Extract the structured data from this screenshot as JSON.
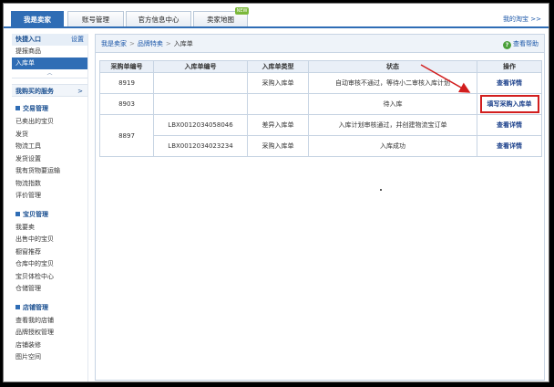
{
  "top_tabs": [
    {
      "label": "我是卖家",
      "active": true
    },
    {
      "label": "账号管理",
      "active": false
    },
    {
      "label": "官方信息中心",
      "active": false
    },
    {
      "label": "卖家地图",
      "active": false
    }
  ],
  "new_badge": "NEW",
  "my_taobao": "我的淘宝 >>",
  "sidebar": {
    "quick_entry": "快捷入口",
    "settings": "设置",
    "quick_items": [
      "提报商品",
      "入库单"
    ],
    "purchased_service": "我购买的服务",
    "service_arrow": ">",
    "groups": [
      {
        "title": "交易管理",
        "items": [
          "已卖出的宝贝",
          "发货",
          "物流工具",
          "发货设置",
          "我有货物要运输",
          "物流指数",
          "评价管理"
        ]
      },
      {
        "title": "宝贝管理",
        "items": [
          "我要卖",
          "出售中的宝贝",
          "橱窗推荐",
          "仓库中的宝贝",
          "宝贝体检中心",
          "仓储管理"
        ]
      },
      {
        "title": "店铺管理",
        "items": [
          "查看我的店铺",
          "品牌授权管理",
          "店铺装修",
          "图片空间"
        ]
      }
    ]
  },
  "breadcrumb": [
    "我是卖家",
    "品牌特卖",
    "入库单"
  ],
  "help": "查看帮助",
  "table": {
    "headers": [
      "采购单编号",
      "入库单编号",
      "入库单类型",
      "状态",
      "操作"
    ],
    "rows": [
      {
        "po": "8919",
        "inbound": "",
        "type": "采购入库单",
        "status": "自动审核不通过，等待小二审核入库计划",
        "action": "查看详情"
      },
      {
        "po": "8903",
        "inbound": "",
        "type": "",
        "status": "待入库",
        "action": "填写采购入库单"
      },
      {
        "po": "8897",
        "inbound": "LBX0012034058046",
        "type": "差异入库单",
        "status": "入库计划审核通过，并创建物流宝订单",
        "action": "查看详情"
      },
      {
        "po": "",
        "inbound": "LBX0012034023234",
        "type": "采购入库单",
        "status": "入库成功",
        "action": "查看详情"
      }
    ]
  },
  "colors": {
    "accent": "#2f6db5",
    "highlight": "#d21e1e",
    "link": "#1a3f8a"
  }
}
